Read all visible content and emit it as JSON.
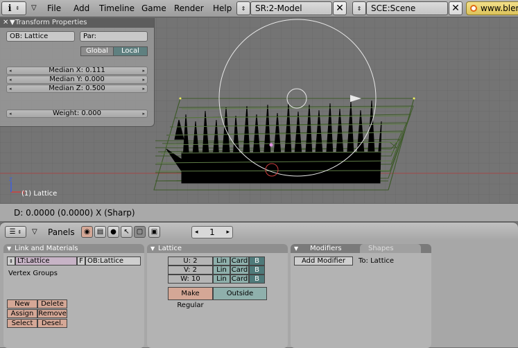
{
  "topbar": {
    "menus": [
      "File",
      "Add",
      "Timeline",
      "Game",
      "Render",
      "Help"
    ],
    "screen_field": "SR:2-Model",
    "scene_field": "SCE:Scene",
    "url_text": "www.bler"
  },
  "transform_panel": {
    "title": "Transform Properties",
    "ob_field": "OB: Lattice",
    "par_field": "Par:",
    "global_label": "Global",
    "local_label": "Local",
    "median_x": "Median X: 0.111",
    "median_y": "Median Y: 0.000",
    "median_z": "Median Z: 0.500",
    "weight": "Weight: 0.000"
  },
  "viewport": {
    "object_label": "(1) Lattice",
    "status_text": "D: 0.0000 (0.0000)  X (Sharp)"
  },
  "buttons_header": {
    "panels_label": "Panels",
    "page_number": "1"
  },
  "link_materials": {
    "title": "Link and Materials",
    "lt_field": "LT:Lattice",
    "f_label": "F",
    "ob_field": "OB:Lattice",
    "vertex_groups": "Vertex Groups",
    "new": "New",
    "delete": "Delete",
    "assign": "Assign",
    "remove": "Remove",
    "select": "Select",
    "deselect": "Desel."
  },
  "lattice": {
    "title": "Lattice",
    "rows": [
      {
        "label": "U: 2",
        "lin": "Lin",
        "card": "Card",
        "b": "B"
      },
      {
        "label": "V: 2",
        "lin": "Lin",
        "card": "Card",
        "b": "B"
      },
      {
        "label": "W: 10",
        "lin": "Lin",
        "card": "Card",
        "b": "B"
      }
    ],
    "make_regular": "Make Regular",
    "outside": "Outside"
  },
  "modifiers": {
    "tab_modifiers": "Modifiers",
    "tab_shapes": "Shapes",
    "add_modifier": "Add Modifier",
    "to_label": "To: Lattice"
  },
  "colors": {
    "grid_line": "#6a6a6a",
    "lattice_edge": "#3e5a2a",
    "x_axis": "#a04848",
    "accent_salmon": "#d4a796",
    "accent_teal": "#8fb0ac"
  }
}
